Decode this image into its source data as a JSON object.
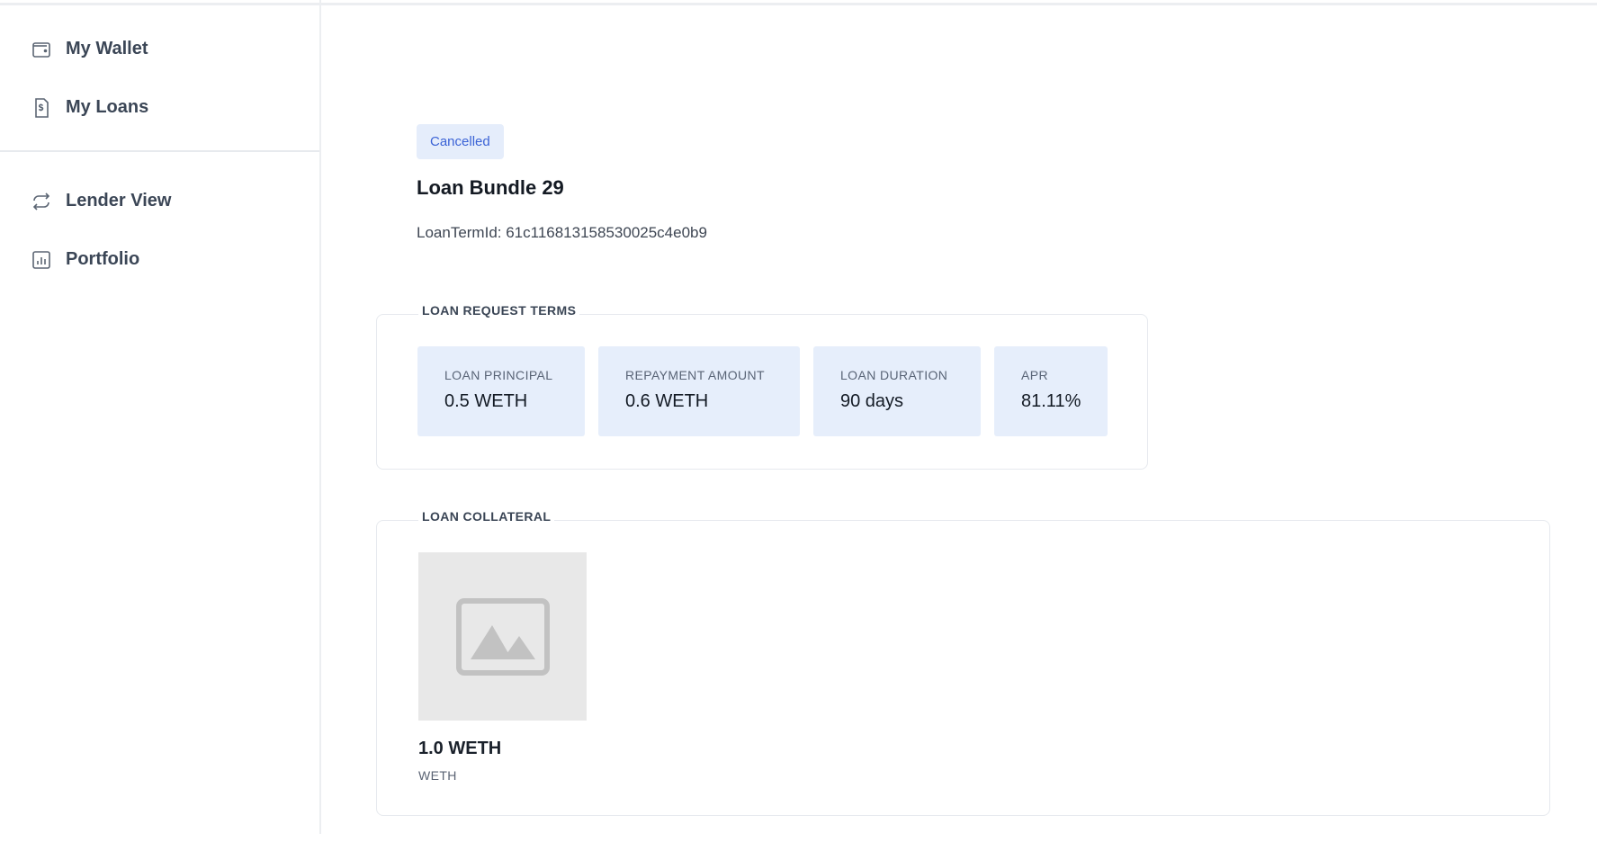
{
  "sidebar": {
    "items": [
      {
        "label": "My Wallet",
        "icon": "wallet-icon"
      },
      {
        "label": "My Loans",
        "icon": "loan-document-icon"
      },
      {
        "label": "Lender View",
        "icon": "exchange-icon"
      },
      {
        "label": "Portfolio",
        "icon": "bar-chart-icon"
      }
    ]
  },
  "loan": {
    "status": "Cancelled",
    "title": "Loan Bundle 29",
    "loan_term_id": "LoanTermId: 61c116813158530025c4e0b9"
  },
  "terms": {
    "legend": "LOAN REQUEST TERMS",
    "stats": [
      {
        "label": "LOAN PRINCIPAL",
        "value": "0.5 WETH"
      },
      {
        "label": "REPAYMENT AMOUNT",
        "value": "0.6 WETH"
      },
      {
        "label": "LOAN DURATION",
        "value": "90 days"
      },
      {
        "label": "APR",
        "value": "81.11%"
      }
    ]
  },
  "collateral": {
    "legend": "LOAN COLLATERAL",
    "items": [
      {
        "amount": "1.0 WETH",
        "symbol": "WETH",
        "image": "image-placeholder-icon"
      }
    ]
  },
  "colors": {
    "accent": "#3b63d6",
    "badge_bg": "#e5edfb",
    "stat_bg": "#e6eefb",
    "border": "#e6e9ee"
  }
}
